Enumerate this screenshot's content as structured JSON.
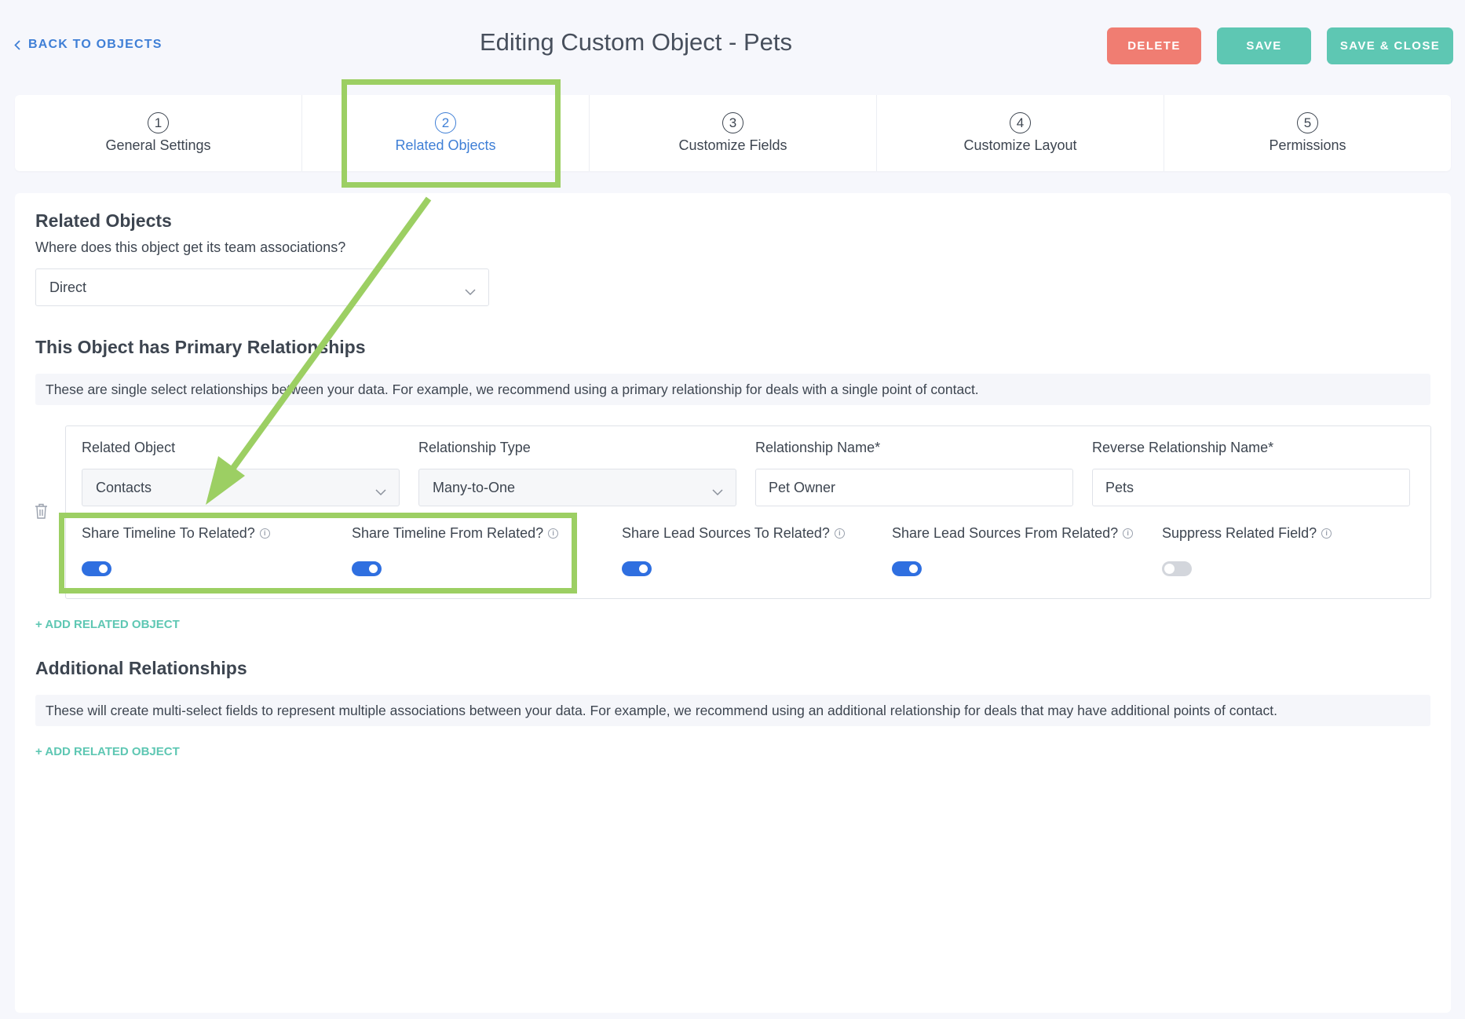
{
  "header": {
    "back_label": "BACK TO OBJECTS",
    "title": "Editing Custom Object - Pets",
    "delete_label": "DELETE",
    "save_label": "SAVE",
    "save_close_label": "SAVE & CLOSE"
  },
  "steps": [
    {
      "num": "1",
      "label": "General Settings",
      "active": false
    },
    {
      "num": "2",
      "label": "Related Objects",
      "active": true
    },
    {
      "num": "3",
      "label": "Customize Fields",
      "active": false
    },
    {
      "num": "4",
      "label": "Customize Layout",
      "active": false
    },
    {
      "num": "5",
      "label": "Permissions",
      "active": false
    }
  ],
  "related_objects": {
    "title": "Related Objects",
    "question": "Where does this object get its team associations?",
    "association_value": "Direct"
  },
  "primary": {
    "title": "This Object has Primary Relationships",
    "info": "These are single select relationships between your data. For example, we recommend using a primary relationship for deals with a single point of contact.",
    "related_object_label": "Related Object",
    "related_object_value": "Contacts",
    "relationship_type_label": "Relationship Type",
    "relationship_type_value": "Many-to-One",
    "relationship_name_label": "Relationship Name*",
    "relationship_name_value": "Pet Owner",
    "reverse_name_label": "Reverse Relationship Name*",
    "reverse_name_value": "Pets",
    "toggles": [
      {
        "label": "Share Timeline To Related?",
        "on": true
      },
      {
        "label": "Share Timeline From Related?",
        "on": true
      },
      {
        "label": "Share Lead Sources To Related?",
        "on": true
      },
      {
        "label": "Share Lead Sources From Related?",
        "on": true
      },
      {
        "label": "Suppress Related Field?",
        "on": false
      }
    ],
    "add_label": "+ ADD RELATED OBJECT"
  },
  "additional": {
    "title": "Additional Relationships",
    "info": "These will create multi-select fields to represent multiple associations between your data. For example, we recommend using an additional relationship for deals that may have additional points of contact.",
    "add_label": "+ ADD RELATED OBJECT"
  },
  "colors": {
    "accent_blue": "#3f7fd6",
    "toggle_on": "#2f6fe0",
    "delete_red": "#f07d72",
    "save_teal": "#5ec7b3",
    "highlight_green": "#9ccf63"
  },
  "icons": {
    "back": "chevron-left-icon",
    "dropdown": "chevron-down-icon",
    "delete_row": "trash-icon",
    "info": "info-icon"
  }
}
